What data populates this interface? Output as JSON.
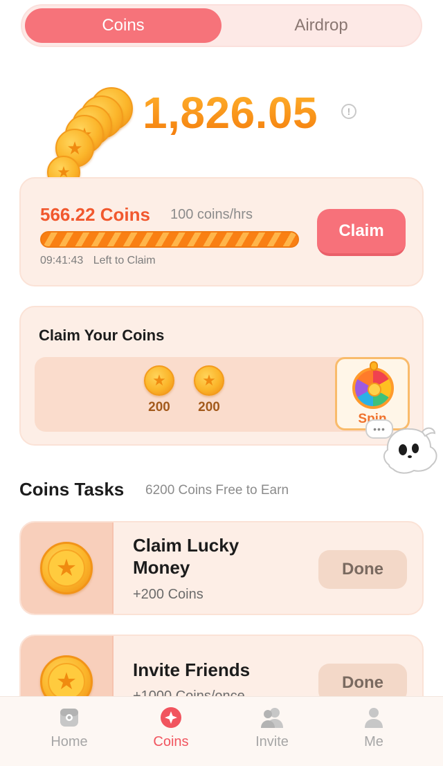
{
  "tabs": [
    {
      "label": "Coins",
      "active": true
    },
    {
      "label": "Airdrop",
      "active": false
    }
  ],
  "balance": {
    "amount": "1,826.05",
    "info_icon": "info-icon"
  },
  "mining": {
    "amount": "566.22 Coins",
    "rate": "100 coins/hrs",
    "progress_percent": 100,
    "countdown": "09:41:43",
    "countdown_label": "Left to Claim",
    "claim_label": "Claim"
  },
  "claim_coins": {
    "title": "Claim Your Coins",
    "slots": [
      {
        "value": "200"
      },
      {
        "value": "200"
      }
    ],
    "spin_label": "Spin",
    "bubble": "•••"
  },
  "tasks": {
    "title": "Coins Tasks",
    "subtitle": "6200 Coins Free to Earn",
    "items": [
      {
        "name": "Claim Lucky Money",
        "reward": "+200 Coins",
        "button": "Done"
      },
      {
        "name": "Invite Friends",
        "reward": "+1000 Coins/once",
        "button": "Done"
      }
    ]
  },
  "nav": [
    {
      "label": "Home",
      "icon": "home-icon",
      "active": false
    },
    {
      "label": "Coins",
      "icon": "coins-icon",
      "active": true
    },
    {
      "label": "Invite",
      "icon": "invite-icon",
      "active": false
    },
    {
      "label": "Me",
      "icon": "profile-icon",
      "active": false
    }
  ],
  "colors": {
    "accent": "#f6737a",
    "coin": "#fbb52a",
    "balance": "#f99a1a",
    "card_bg": "#fdeee6"
  }
}
